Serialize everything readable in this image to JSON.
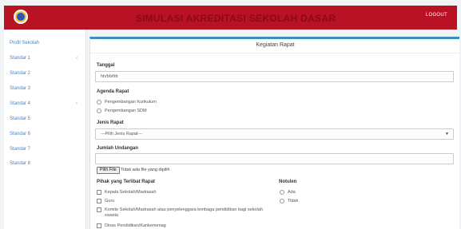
{
  "header": {
    "title": "SIMULASI AKREDITASI SEKOLAH DASAR",
    "logout_label": "LOGOUT",
    "brand_color": "#b81224"
  },
  "sidebar": {
    "items": [
      {
        "label": "Profil Sekolah",
        "has_submenu": false
      },
      {
        "label": "Standar 1",
        "has_submenu": true
      },
      {
        "label": "Standar 2",
        "has_submenu": false
      },
      {
        "label": "Standar 3",
        "has_submenu": false
      },
      {
        "label": "Standar 4",
        "has_submenu": true
      },
      {
        "label": "Standar 5",
        "has_submenu": false
      },
      {
        "label": "Standar 6",
        "has_submenu": false
      },
      {
        "label": "Standar 7",
        "has_submenu": false
      },
      {
        "label": "Standar 8",
        "has_submenu": false
      }
    ],
    "chevron": "‹"
  },
  "panel": {
    "title": "Kegiatan Rapat",
    "accent_color": "#3c8dbc"
  },
  "form": {
    "tanggal": {
      "label": "Tanggal",
      "value": "hh/bb/tttt"
    },
    "agenda": {
      "label": "Agenda Rapat",
      "options": [
        "Pengembangan Kurikulum",
        "Pengembangan SDM"
      ]
    },
    "jenis": {
      "label": "Jenis Rapat",
      "selected": "---Pilih Jenis Rapat---",
      "arrow": "▼"
    },
    "undangan": {
      "label": "Jumlah Undangan",
      "file_button": "Pilih File",
      "file_status": "Tidak ada file yang dipilih"
    },
    "pihak": {
      "label": "Pihak yang Terlibat Rapat",
      "options": [
        "Kepala Sekolah/Madrasah",
        "Guru",
        "Komite Sekolah/Madrasah atau penyelenggara lembaga pendidikan bagi sekolah swasta",
        "Dinas Pendidikan/Kankemenag"
      ]
    },
    "notulen": {
      "label": "Notulen",
      "options": [
        "Ada",
        "Tidak"
      ]
    }
  }
}
